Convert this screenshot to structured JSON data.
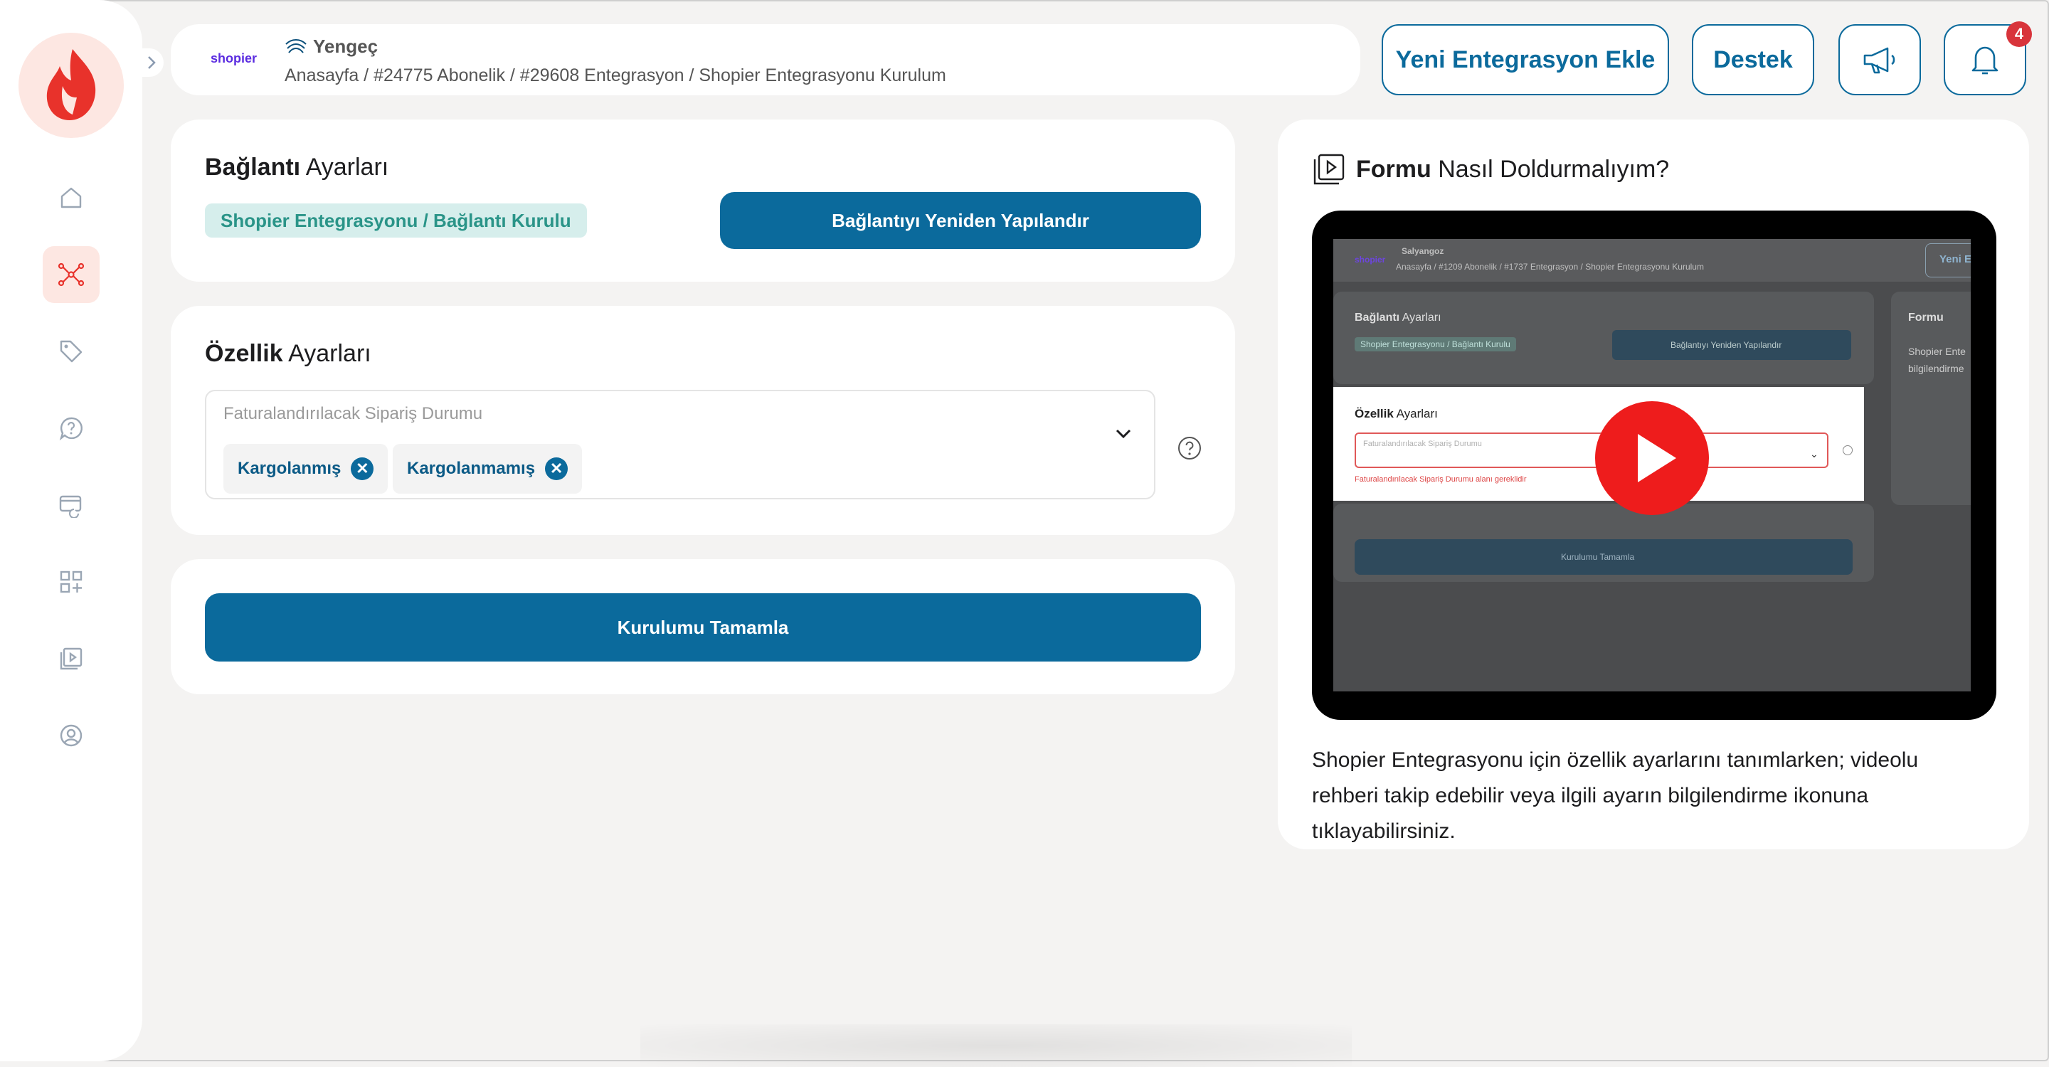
{
  "sidebar": {
    "items": [
      {
        "name": "home-icon"
      },
      {
        "name": "integration-icon",
        "active": true
      },
      {
        "name": "tag-icon"
      },
      {
        "name": "support-chat-icon"
      },
      {
        "name": "billing-icon"
      },
      {
        "name": "apps-add-icon"
      },
      {
        "name": "video-library-icon"
      },
      {
        "name": "user-profile-icon"
      }
    ],
    "accent": "#e8322b"
  },
  "header": {
    "shop_logo_text": "shopier",
    "company": "Yengeç",
    "breadcrumb": "Anasayfa / #24775 Abonelik / #29608 Entegrasyon / Shopier Entegrasyonu Kurulum",
    "new_integration_label": "Yeni Entegrasyon Ekle",
    "support_label": "Destek",
    "notification_count": "4"
  },
  "connection": {
    "title_bold": "Bağlantı",
    "title_rest": " Ayarları",
    "status": "Shopier Entegrasyonu / Bağlantı Kurulu",
    "reconfigure_label": "Bağlantıyı Yeniden Yapılandır"
  },
  "features": {
    "title_bold": "Özellik",
    "title_rest": " Ayarları",
    "field_placeholder": "Faturalandırılacak Sipariş Durumu",
    "tags": [
      "Kargolanmış",
      "Kargolanmamış"
    ]
  },
  "complete_label": "Kurulumu Tamamla",
  "guide": {
    "title_bold": "Formu",
    "title_rest": " Nasıl Doldurmalıyım?",
    "description": "Shopier Entegrasyonu için özellik ayarlarını tanımlarken; videolu rehberi takip edebilir veya ilgili ayarın bilgilendirme ikonuna tıklayabilirsiniz."
  },
  "video": {
    "company": "Salyangoz",
    "breadcrumb": "Anasayfa / #1209 Abonelik / #1737 Entegrasyon / Shopier Entegrasyonu Kurulum",
    "new_btn": "Yeni E",
    "conn_title_bold": "Bağlantı",
    "conn_title_rest": " Ayarları",
    "conn_status": "Shopier Entegrasyonu / Bağlantı Kurulu",
    "reconf": "Bağlantıyı Yeniden Yapılandır",
    "side_title": "Formu",
    "side_desc_1": "Shopier Ente",
    "side_desc_2": "bilgilendirme",
    "feat_title_bold": "Özellik",
    "feat_title_rest": " Ayarları",
    "feat_placeholder": "Faturalandırılacak Sipariş Durumu",
    "feat_error": "Faturalandırılacak Sipariş Durumu alanı gereklidir",
    "complete": "Kurulumu Tamamla"
  }
}
